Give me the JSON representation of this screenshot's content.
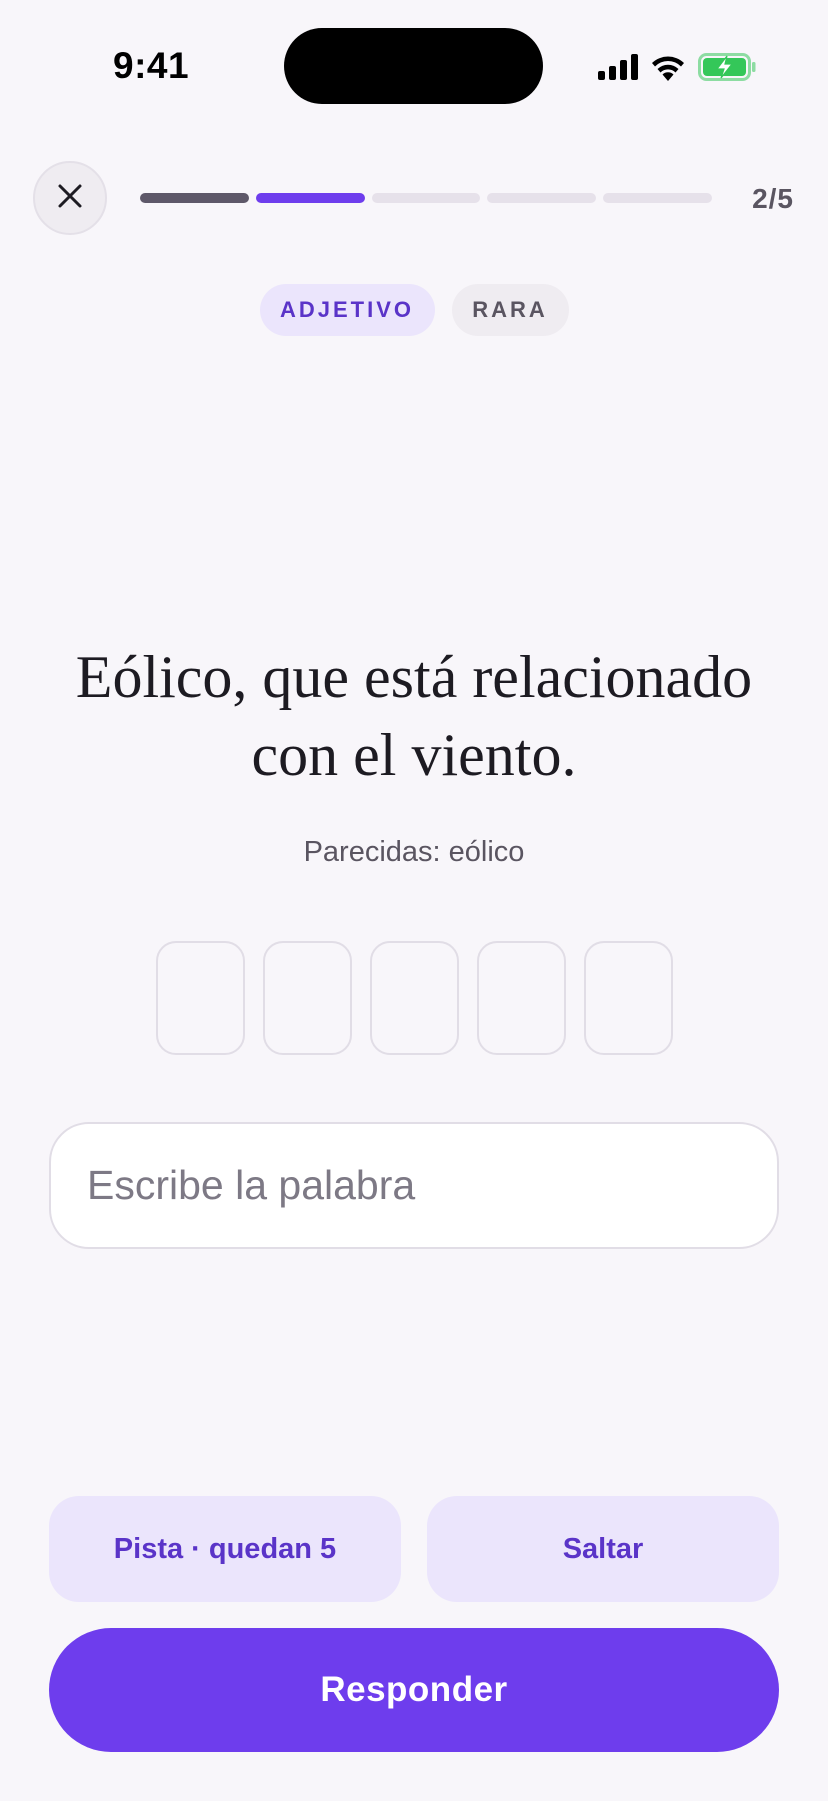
{
  "status_bar": {
    "time": "9:41",
    "icons": [
      "signal-icon",
      "wifi-icon",
      "battery-charging-icon"
    ],
    "battery_color": "#34c759"
  },
  "header": {
    "close_icon": "close-icon",
    "progress": {
      "total": 5,
      "current": 2,
      "completed": 1
    },
    "counter": "2/5"
  },
  "tags": {
    "part_of_speech": "ADJETIVO",
    "rarity": "RARA"
  },
  "question": {
    "definition": "Eólico, que está relacionado con el viento.",
    "similar": "Parecidas: eólico",
    "letter_count": 5
  },
  "answer": {
    "placeholder": "Escribe la palabra",
    "value": ""
  },
  "actions": {
    "hint_label": "Pista · quedan 5",
    "skip_label": "Saltar",
    "submit_label": "Responder"
  },
  "colors": {
    "accent": "#6e3ded",
    "accent_soft": "#ebe5fc",
    "background": "#f8f6fa"
  }
}
